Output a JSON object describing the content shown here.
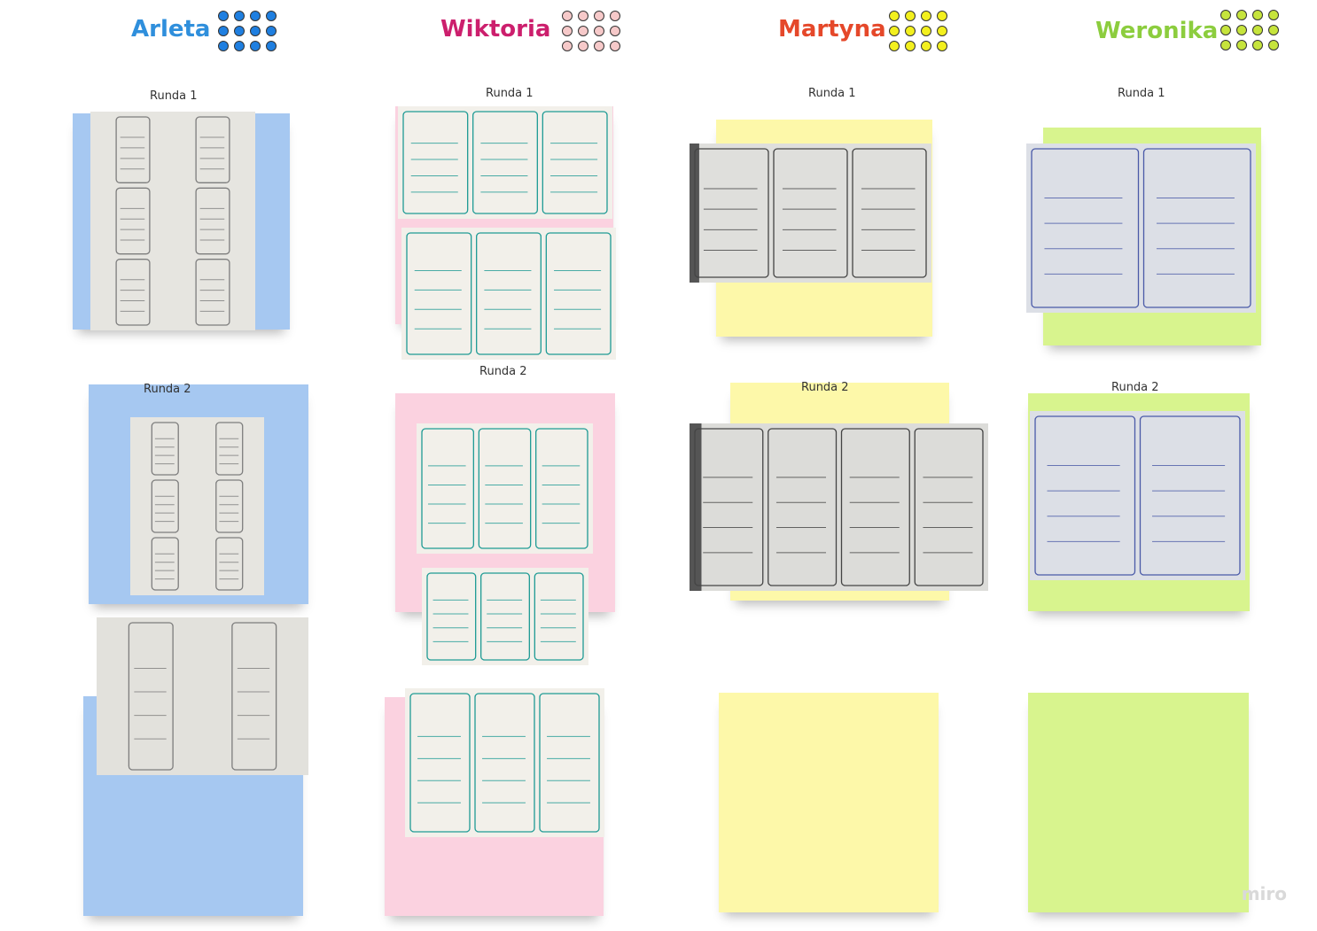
{
  "board": {
    "watermark": "miro"
  },
  "people": [
    {
      "name": "Arleta",
      "color": "#2f8fdc",
      "dot_color": "#1f7fe0"
    },
    {
      "name": "Wiktoria",
      "color": "#cc1f6d",
      "dot_color": "#f6c9c9"
    },
    {
      "name": "Martyna",
      "color": "#e5482a",
      "dot_color": "#f3f01e"
    },
    {
      "name": "Weronika",
      "color": "#8ccd3e",
      "dot_color": "#c6e43c"
    }
  ],
  "rounds": {
    "round1": "Runda 1",
    "round2": "Runda 2"
  },
  "photos": [
    {
      "id": "arleta-r1",
      "alt": "Arleta sketch round 1"
    },
    {
      "id": "arleta-r2a",
      "alt": "Arleta sketch round 2"
    },
    {
      "id": "arleta-r2b",
      "alt": "Arleta sketch round 2 second page"
    },
    {
      "id": "wiktoria-r1a",
      "alt": "Wiktoria sketch round 1"
    },
    {
      "id": "wiktoria-r1b",
      "alt": "Wiktoria sketch round 1 second page"
    },
    {
      "id": "wiktoria-r2a",
      "alt": "Wiktoria sketch round 2"
    },
    {
      "id": "wiktoria-r2b",
      "alt": "Wiktoria sketch round 2 second page"
    },
    {
      "id": "wiktoria-r3",
      "alt": "Wiktoria sketch third page"
    },
    {
      "id": "martyna-r1",
      "alt": "Martyna sketch round 1"
    },
    {
      "id": "martyna-r2",
      "alt": "Martyna sketch round 2"
    },
    {
      "id": "weronika-r1",
      "alt": "Weronika sketch round 1"
    },
    {
      "id": "weronika-r2",
      "alt": "Weronika sketch round 2"
    }
  ]
}
